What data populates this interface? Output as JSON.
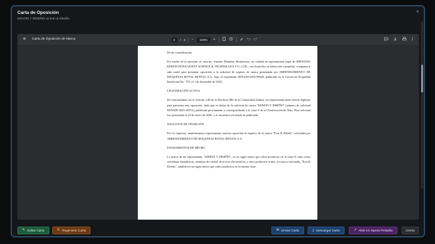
{
  "modal": {
    "title": "Carta de Oposición",
    "subtitle": "KEHON Y DISEÑO vs Eon & Diseño",
    "close_icon": "×"
  },
  "viewer": {
    "document_title": "Carta de Oposición de Marca",
    "menu_icon": "≡",
    "page_current": "2",
    "page_total": "4",
    "zoom": "100%",
    "zoom_out_icon": "−",
    "zoom_in_icon": "+",
    "icons_center": [
      "fit-page-icon",
      "history-icon",
      "draw-icon",
      "undo-icon",
      "redo-icon"
    ],
    "icons_right": [
      "comment-icon",
      "download-icon",
      "print-icon",
      "more-icon"
    ]
  },
  "document": {
    "paragraphs": [
      {
        "type": "text",
        "text": "De mi consideración:"
      },
      {
        "type": "text",
        "text": "Por medio de la presente, el suscrito, Antonio Martínez Montesinos, en calidad de representante legal de ZHEJIANG KEHON INTELLIGENT SCIENCE & TECHNOLOGY CO., LTD., con domicilio en [dirección completa], comparezco ante usted para presentar oposición a la solicitud de registro de marca presentada por ARRENDAMIENTO DE MÁQUINAS ROYAL RENTAL S.A., bajo el expediente SENADI-2025-99620, publicada en la Gaceta de Propiedad Intelectual No. 755, el 1 de diciembre de 2025."
      },
      {
        "type": "heading",
        "text": "LEGITIMACIÓN ACTIVA"
      },
      {
        "type": "text",
        "text": "De conformidad con el Artículo 146 de la Decisión 486 de la Comunidad Andina, mi representada tiene interés legítimo para presentar esta oposición, dado que es titular de la solicitud de marca \"KEHON Y DISEÑO\" (número de solicitud SENADI-2025-45551), publicada previamente y correspondiente a la clase 9 de la Clasificación de Niza. Esta solicitud fue presentada el 23 de enero de 2026, y se encuentra en estado de publicada."
      },
      {
        "type": "heading",
        "text": "SOLICITUD DE OPOSICIÓN"
      },
      {
        "type": "text",
        "text": "Por lo expuesto, manifestamos expresamente nuestra oposición al registro de la marca \"Eon & Diseño\" solicitada por ARRENDAMIENTO DE MÁQUINAS ROYAL RENTAL S.A."
      },
      {
        "type": "heading",
        "text": "FUNDAMENTOS DE HECHO"
      },
      {
        "type": "text",
        "text": "La marca de mi representada, \"KEHON Y DISEÑO\", es un signo mixto que cubre productos en la clase 9, tales como cerraduras biométricas, sistemas de control de acceso electrónicos, y otros productos afines. La marca solicitada, \"Eon & Diseño\", también es un signo mixto que cubre productos en la misma clase."
      }
    ]
  },
  "footer": {
    "edit_label": "Editar Carta",
    "regenerate_label": "Regenerar Carta",
    "send_label": "Enviar Carta",
    "download_label": "Descargar Carta",
    "open_tab_label": "Abrir en Nueva Pestaña",
    "close_label": "Cerrar"
  },
  "colors": {
    "modal_border": "#3b5b7a",
    "green": "#1d5a3c",
    "orange": "#6a3a16",
    "blue": "#1c3f6b",
    "purple": "#4a2460"
  }
}
